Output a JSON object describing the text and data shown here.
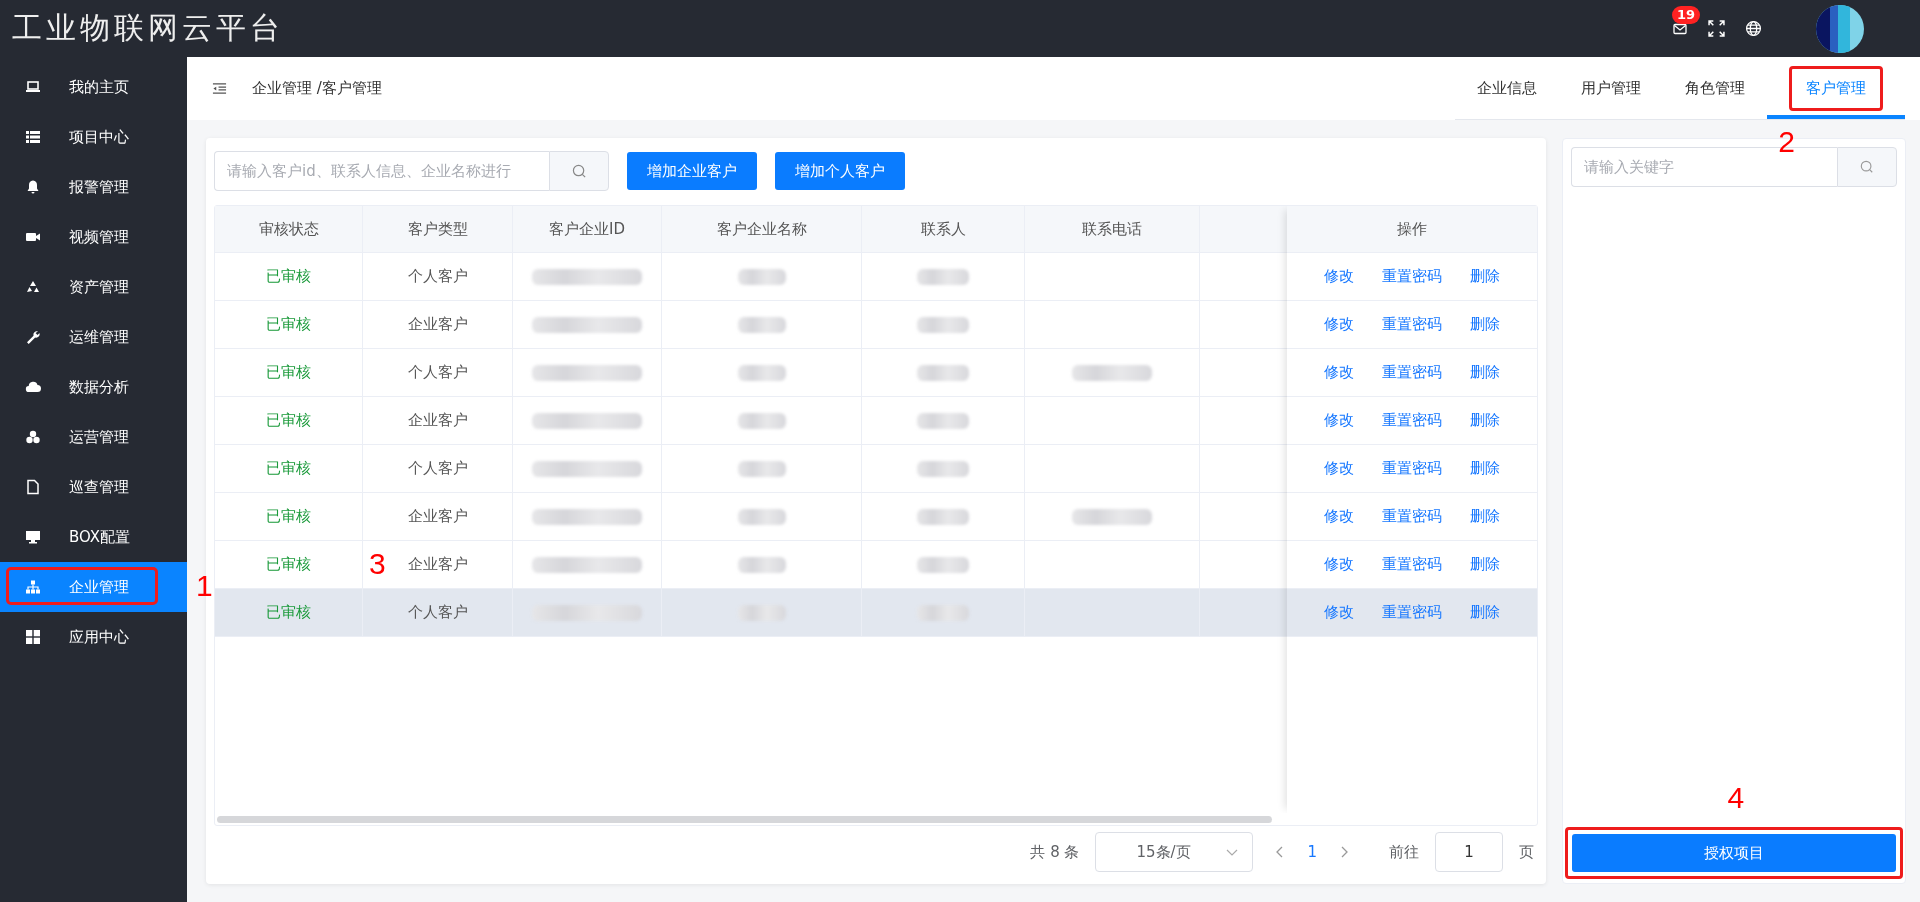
{
  "app_title": "工业物联网云平台",
  "top_bar": {
    "mail_badge": "19"
  },
  "sidebar": {
    "items": [
      {
        "label": "我的主页",
        "selected": false
      },
      {
        "label": "项目中心",
        "selected": false
      },
      {
        "label": "报警管理",
        "selected": false
      },
      {
        "label": "视频管理",
        "selected": false
      },
      {
        "label": "资产管理",
        "selected": false
      },
      {
        "label": "运维管理",
        "selected": false
      },
      {
        "label": "数据分析",
        "selected": false
      },
      {
        "label": "运营管理",
        "selected": false
      },
      {
        "label": "巡查管理",
        "selected": false
      },
      {
        "label": "BOX配置",
        "selected": false
      },
      {
        "label": "企业管理",
        "selected": true,
        "callout": "1"
      },
      {
        "label": "应用中心",
        "selected": false
      }
    ]
  },
  "breadcrumb": "企业管理 /客户管理",
  "tabs": [
    {
      "label": "企业信息",
      "selected": false
    },
    {
      "label": "用户管理",
      "selected": false
    },
    {
      "label": "角色管理",
      "selected": false
    },
    {
      "label": "客户管理",
      "selected": true,
      "callout": "2"
    }
  ],
  "search": {
    "placeholder": "请输入客户id、联系人信息、企业名称进行"
  },
  "buttons": [
    "增加企业客户",
    "增加个人客户"
  ],
  "table": {
    "columns": [
      "审核状态",
      "客户类型",
      "客户企业ID",
      "客户企业名称",
      "联系人",
      "联系电话"
    ],
    "action_column": "操作",
    "rows": [
      {
        "status": "已审核",
        "type": "个人客户",
        "blurred": [
          true,
          true,
          true,
          false
        ],
        "hovered": false,
        "actions": [
          "修改",
          "重置密码",
          "删除"
        ]
      },
      {
        "status": "已审核",
        "type": "企业客户",
        "blurred": [
          true,
          true,
          true,
          false
        ],
        "hovered": false,
        "actions": [
          "修改",
          "重置密码",
          "删除"
        ]
      },
      {
        "status": "已审核",
        "type": "个人客户",
        "blurred": [
          true,
          true,
          true,
          true
        ],
        "hovered": false,
        "actions": [
          "修改",
          "重置密码",
          "删除"
        ]
      },
      {
        "status": "已审核",
        "type": "企业客户",
        "blurred": [
          true,
          true,
          true,
          false
        ],
        "hovered": false,
        "actions": [
          "修改",
          "重置密码",
          "删除"
        ]
      },
      {
        "status": "已审核",
        "type": "个人客户",
        "blurred": [
          true,
          true,
          true,
          false
        ],
        "hovered": false,
        "actions": [
          "修改",
          "重置密码",
          "删除"
        ]
      },
      {
        "status": "已审核",
        "type": "企业客户",
        "blurred": [
          true,
          true,
          true,
          true
        ],
        "hovered": false,
        "actions": [
          "修改",
          "重置密码",
          "删除"
        ]
      },
      {
        "status": "已审核",
        "type": "企业客户",
        "blurred": [
          true,
          true,
          true,
          false
        ],
        "hovered": false,
        "callout": "3",
        "actions": [
          "修改",
          "重置密码",
          "删除"
        ]
      },
      {
        "status": "已审核",
        "type": "个人客户",
        "blurred": [
          true,
          true,
          true,
          false
        ],
        "hovered": true,
        "actions": [
          "修改",
          "重置密码",
          "删除"
        ]
      }
    ]
  },
  "pagination": {
    "total": "共 8 条",
    "page_size": "15条/页",
    "current_page": "1",
    "goto_label": "前往",
    "goto_value": "1",
    "page_unit": "页"
  },
  "side_panel": {
    "placeholder": "请输入关键字",
    "button": "授权项目",
    "callout": "4"
  }
}
